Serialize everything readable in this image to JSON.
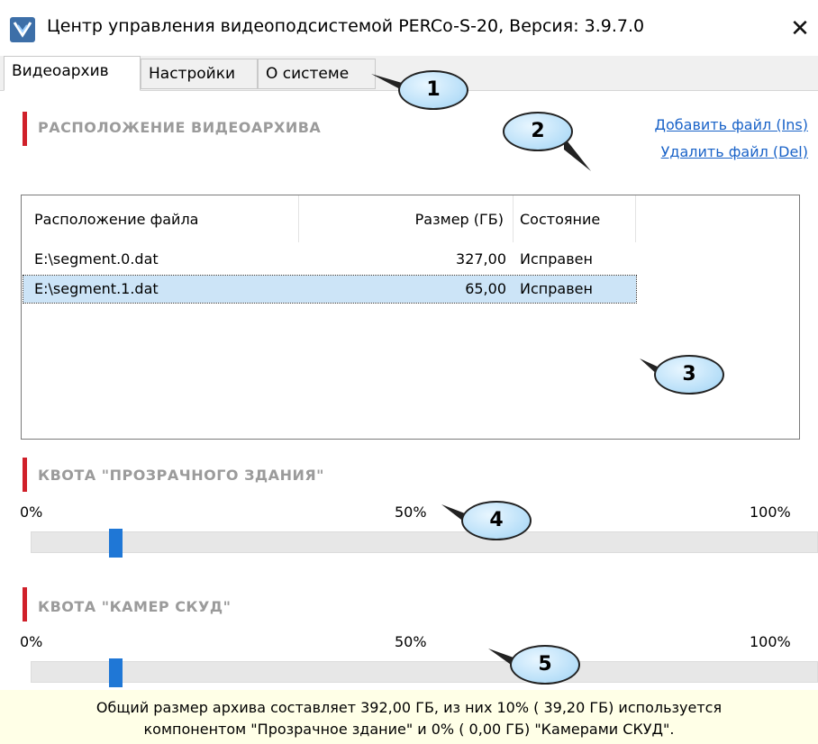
{
  "window": {
    "title": "Центр управления видеоподсистемой PERCo-S-20, Версия: 3.9.7.0",
    "close_glyph": "✕"
  },
  "tabs": [
    {
      "label": "Видеоархив",
      "active": true
    },
    {
      "label": "Настройки",
      "active": false
    },
    {
      "label": "О системе",
      "active": false
    }
  ],
  "archive_section": {
    "title": "РАСПОЛОЖЕНИЕ ВИДЕОАРХИВА",
    "add_link": "Добавить файл (Ins)",
    "remove_link": "Удалить файл (Del)"
  },
  "file_table": {
    "columns": [
      "Расположение файла",
      "Размер (ГБ)",
      "Состояние"
    ],
    "rows": [
      {
        "path": "E:\\segment.0.dat",
        "size": "327,00",
        "state": "Исправен",
        "selected": false
      },
      {
        "path": "E:\\segment.1.dat",
        "size": "65,00",
        "state": "Исправен",
        "selected": true
      }
    ]
  },
  "quota_transparent": {
    "title": "КВОТА \"ПРОЗРАЧНОГО ЗДАНИЯ\"",
    "min_label": "0%",
    "mid_label": "50%",
    "max_label": "100%",
    "value_percent": 10
  },
  "quota_acs": {
    "title": "КВОТА \"КАМЕР СКУД\"",
    "min_label": "0%",
    "mid_label": "50%",
    "max_label": "100%",
    "value_percent": 10
  },
  "summary": {
    "line1": "Общий размер архива составляет  392,00 ГБ, из них 10% ( 39,20 ГБ) используется",
    "line2": "компонентом \"Прозрачное здание\" и 0% ( 0,00 ГБ) \"Камерами СКУД\"."
  },
  "callouts": [
    "1",
    "2",
    "3",
    "4",
    "5"
  ],
  "colors": {
    "accent_bar": "#d0202a",
    "link": "#1a63c8",
    "slider_thumb": "#1f77d6",
    "selection": "#cce4f7"
  }
}
